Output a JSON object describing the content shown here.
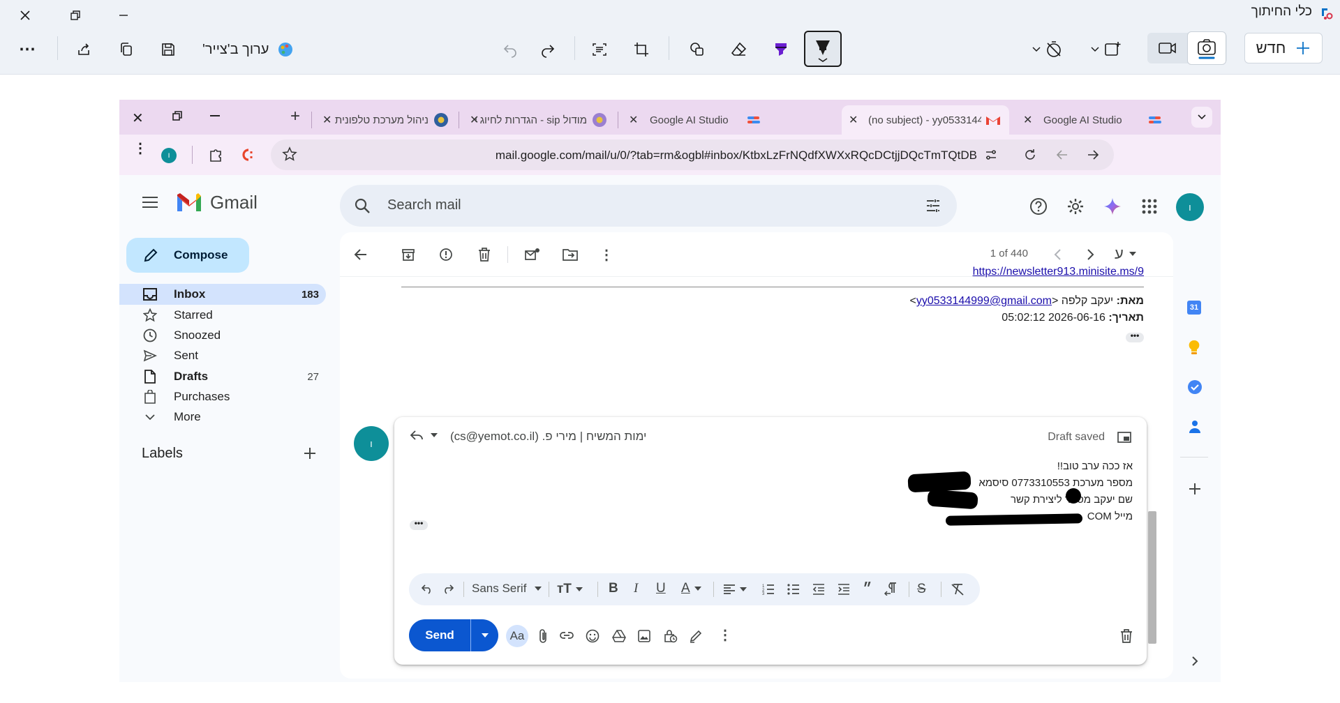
{
  "snipping_tool": {
    "title": "כלי החיתוך",
    "edit_in_paint_label": "ערוך ב'צייר'",
    "new_label": "חדש"
  },
  "browser": {
    "tabs": [
      {
        "title": "ניהול מערכת טלפונית"
      },
      {
        "title": "מודול sip - הגדרות לחיוג ל"
      },
      {
        "title": "Google AI Studio"
      },
      {
        "title": "(no subject) - yy0533144"
      },
      {
        "title": "Google AI Studio"
      }
    ],
    "url": "mail.google.com/mail/u/0/?tab=rm&ogbl#inbox/KtbxLzFrNQdfXWXxRQcDCtjjDQcTmTQtDB",
    "profile_initial": "ו"
  },
  "gmail": {
    "product_name": "Gmail",
    "search_placeholder": "Search mail",
    "compose_label": "Compose",
    "nav": [
      {
        "label": "Inbox",
        "count": "183"
      },
      {
        "label": "Starred",
        "count": ""
      },
      {
        "label": "Snoozed",
        "count": ""
      },
      {
        "label": "Sent",
        "count": ""
      },
      {
        "label": "Drafts",
        "count": "27"
      },
      {
        "label": "Purchases",
        "count": ""
      },
      {
        "label": "More",
        "count": ""
      }
    ],
    "labels_title": "Labels",
    "pager": "1 of 440",
    "input_tool": "ע",
    "avatar_initial": "ו",
    "calendar_day": "31"
  },
  "thread": {
    "link": "https://newsletter913.minisite.ms/9",
    "from_label": "מאת:",
    "from_name": "יעקב קלפה",
    "from_email": "yy0533144999@gmail.com",
    "date_label": "תאריך:",
    "date_value": "2026-06-16 05:02:12"
  },
  "reply": {
    "recipients": "ימות המשיח | מירי פ. (cs@yemot.co.il)",
    "status": "Draft saved",
    "body_lines": [
      "אז ככה ערב טוב!!",
      "מספר מערכת 0773310553 סיסמא",
      "שם יעקב מספר ליצירת קשר",
      "מייל COM"
    ],
    "font_name": "Sans Serif",
    "send_label": "Send",
    "format_label": "Aa"
  }
}
